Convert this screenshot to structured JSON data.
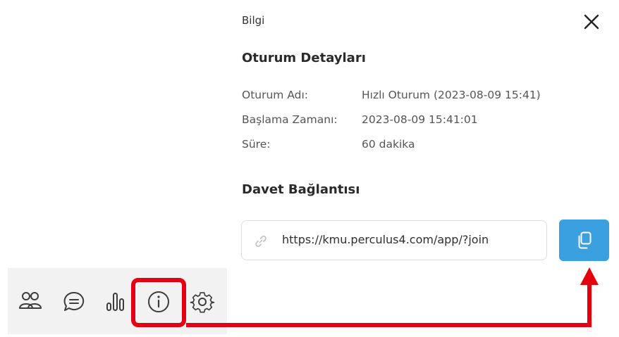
{
  "panel": {
    "title": "Bilgi",
    "close_icon": "close-icon"
  },
  "session": {
    "heading": "Oturum Detayları",
    "rows": [
      {
        "label": "Oturum Adı:",
        "value": "Hızlı Oturum (2023-08-09 15:41)"
      },
      {
        "label": "Başlama Zamanı:",
        "value": "2023-08-09 15:41:01"
      },
      {
        "label": "Süre:",
        "value": "60 dakika"
      }
    ]
  },
  "invite": {
    "heading": "Davet Bağlantısı",
    "url": "https://kmu.perculus4.com/app/?join",
    "link_icon": "link-icon",
    "copy_icon": "copy-icon"
  },
  "toolbar": {
    "items": [
      "participants-icon",
      "chat-icon",
      "stats-icon",
      "info-icon",
      "settings-icon"
    ],
    "highlighted": "info-icon"
  },
  "colors": {
    "accent": "#3aa0e0",
    "highlight": "#e3000f",
    "toolbar_bg": "#f2f2f2"
  }
}
